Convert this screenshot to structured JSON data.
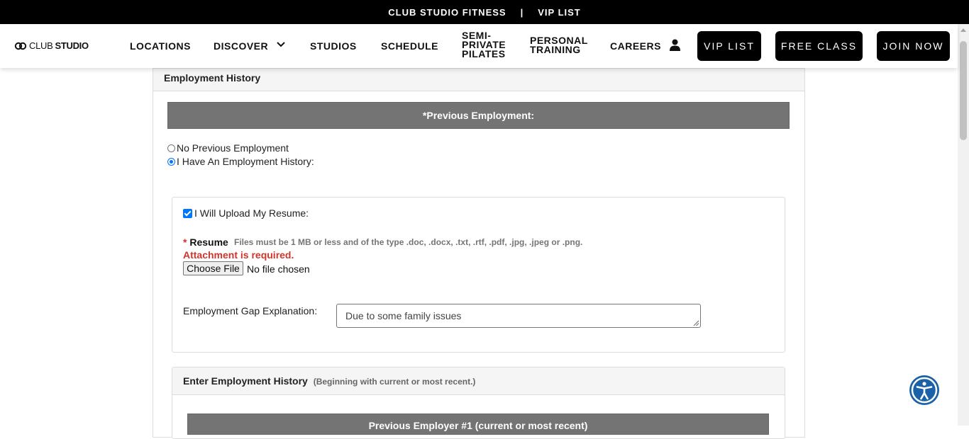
{
  "topbar": {
    "brand": "CLUB STUDIO FITNESS",
    "separator": "|",
    "vip_link": "VIP LIST"
  },
  "nav": {
    "logo_part1": "CLUB",
    "logo_part2": "STUDIO",
    "locations": "LOCATIONS",
    "discover": "DISCOVER",
    "studios": "STUDIOS",
    "schedule": "SCHEDULE",
    "semi_line1": "SEMI-",
    "semi_line2": "PRIVATE",
    "semi_line3": "PILATES",
    "pt_line1": "PERSONAL",
    "pt_line2": "TRAINING",
    "careers": "CAREERS",
    "vip_button": "VIP LIST",
    "free_class_button": "FREE CLASS",
    "join_button": "JOIN NOW",
    "icons": [
      "club-studio-logo-icon",
      "chevron-down-icon",
      "user-icon"
    ]
  },
  "section": {
    "title": "Employment History",
    "previous_employment_header": "*Previous Employment:",
    "radio_none_label": "No Previous Employment",
    "radio_history_label": "I Have An Employment History:",
    "selected_option": "I Have An Employment History:",
    "upload_checkbox_label": "I Will Upload My Resume:",
    "upload_checked": true,
    "resume_required_mark": "*",
    "resume_label": "Resume",
    "resume_hint": "Files must be 1 MB or less and of the type .doc, .docx, .txt, .rtf, .pdf, .jpg, .jpeg or .png.",
    "resume_error": "Attachment is required.",
    "choose_file_label": "Choose File",
    "file_status": "No file chosen",
    "gap_label": "Employment Gap Explanation:",
    "gap_value": "Due to some family issues",
    "history_title": "Enter Employment History",
    "history_subtitle": "(Beginning with current or most recent.)",
    "employer_header": "Previous Employer #1 (current or most recent)"
  },
  "colors": {
    "accent": "#0075ff",
    "error": "#d0342c",
    "header_gray": "#747474",
    "accessibility": "#1a62a8"
  },
  "accessibility_icon": "accessibility-icon"
}
